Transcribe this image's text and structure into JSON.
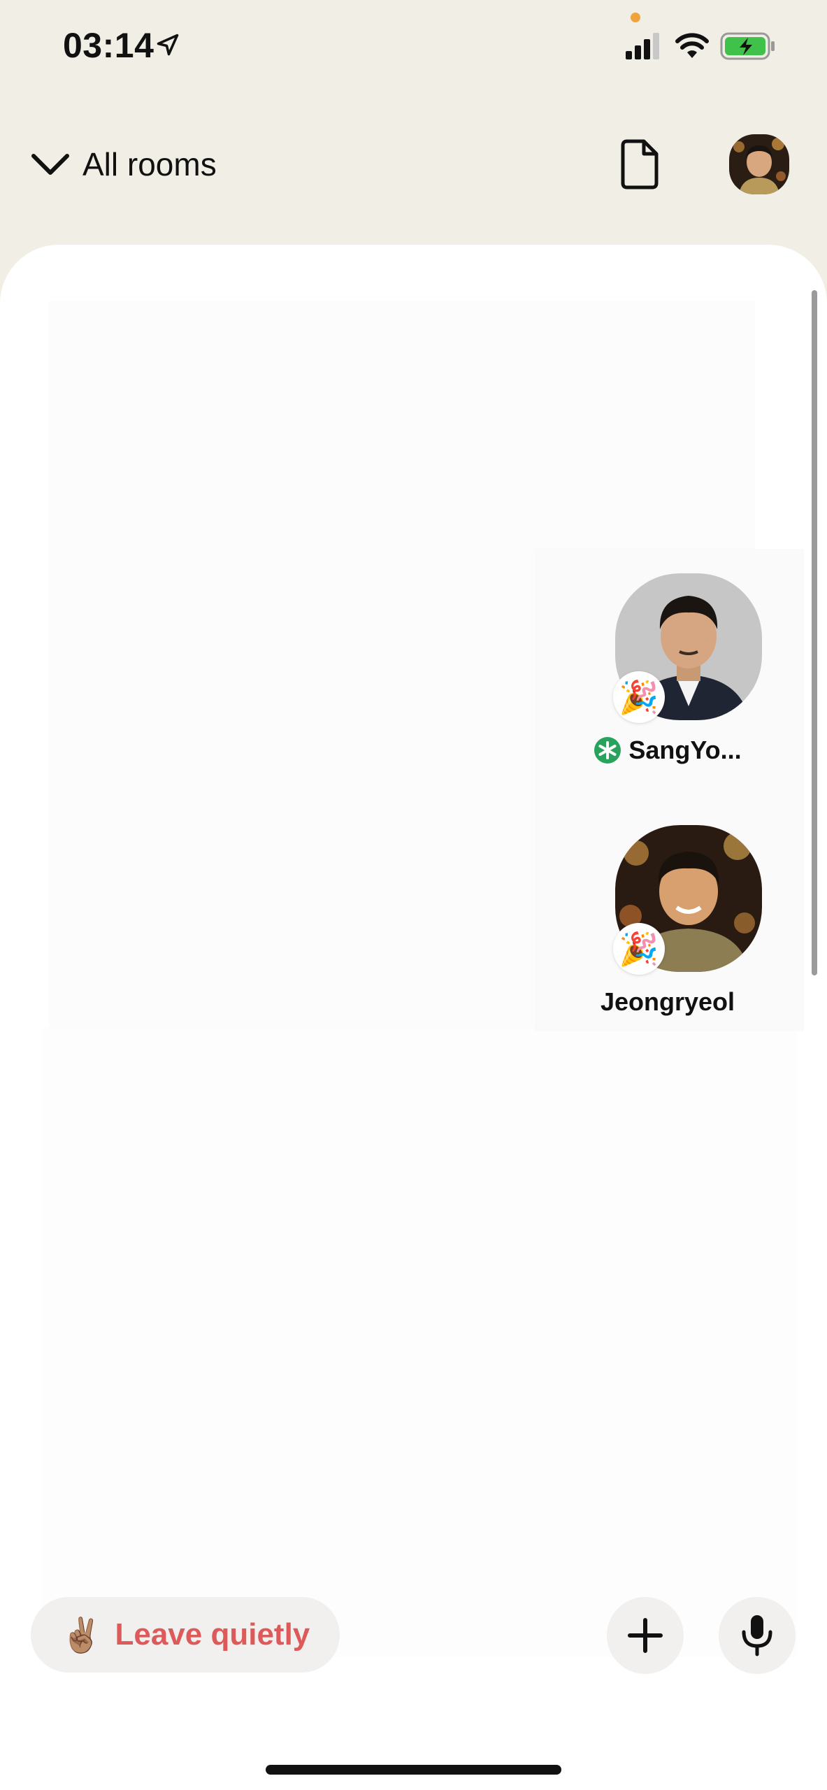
{
  "status_bar": {
    "time": "03:14",
    "icons": [
      "location-arrow-icon",
      "signal-icon",
      "wifi-icon",
      "battery-charging-icon"
    ],
    "battery_color": "#3fc14a",
    "privacy_dot_color": "#f0a33a"
  },
  "header": {
    "back_label": "All rooms",
    "icons": [
      "chevron-down-icon",
      "document-icon",
      "profile-avatar"
    ]
  },
  "room": {
    "speakers": [
      {
        "name": "SangYo...",
        "badge": "🎉",
        "club_badge": true
      },
      {
        "name": "Jeongryeol",
        "badge": "🎉",
        "club_badge": false
      }
    ]
  },
  "bottom_bar": {
    "leave_emoji": "✌🏽",
    "leave_label": "Leave quietly",
    "leave_color": "#dd5a5a",
    "icons": [
      "plus-icon",
      "microphone-icon"
    ]
  },
  "colors": {
    "background": "#f1efe5",
    "sheet": "#ffffff",
    "button_bg": "#f1f0ef",
    "club_green": "#27a35d"
  }
}
